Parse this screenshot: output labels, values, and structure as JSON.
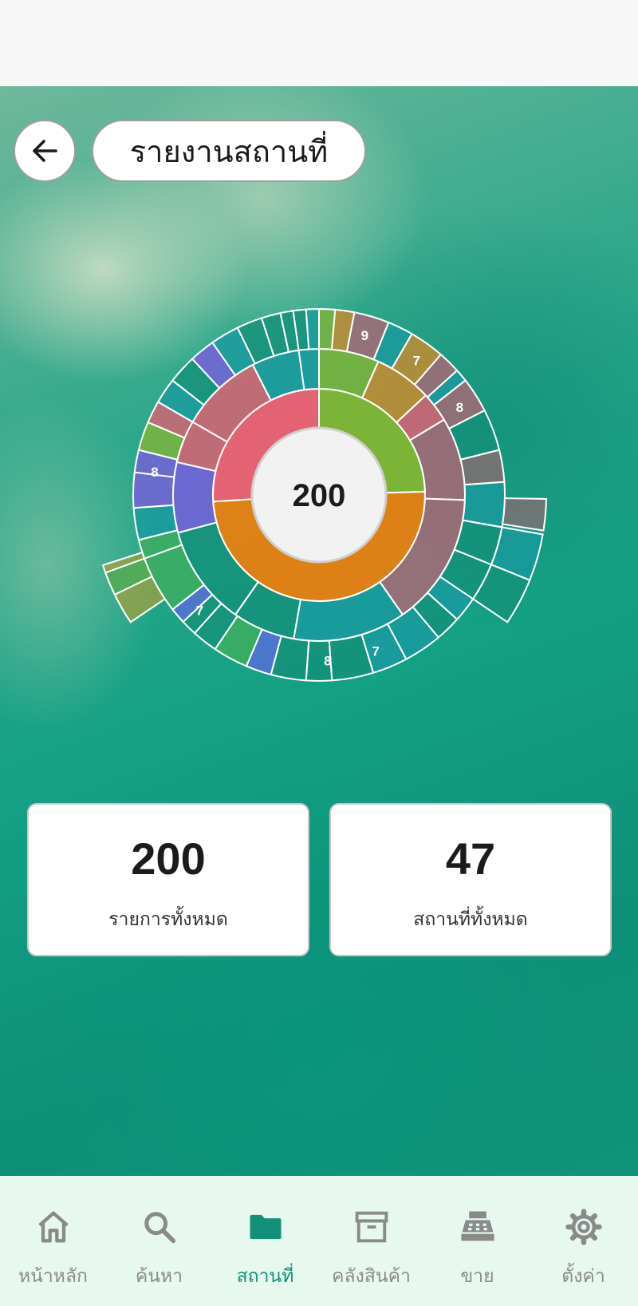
{
  "header": {
    "title": "รายงานสถานที่"
  },
  "colors": {
    "accent": "#14907a",
    "nav_bg": "#e7f9ef",
    "inactive": "#8a8a8a"
  },
  "chart_data": {
    "type": "sunburst",
    "center_label": "200",
    "total": 200,
    "inner_ring": [
      {
        "color": "#82b534",
        "value": 49
      },
      {
        "color": "#e88010",
        "value": 99
      },
      {
        "color": "#ed5f72",
        "value": 52
      }
    ],
    "segment_labels": [
      "9",
      "7",
      "8",
      "8",
      "7",
      "8",
      "7"
    ]
  },
  "stats": [
    {
      "value": "200",
      "label": "รายการทั้งหมด"
    },
    {
      "value": "47",
      "label": "สถานที่ทั้งหมด"
    }
  ],
  "nav": {
    "items": [
      {
        "label": "หน้าหลัก",
        "icon": "home-icon"
      },
      {
        "label": "ค้นหา",
        "icon": "search-icon"
      },
      {
        "label": "สถานที่",
        "icon": "folder-icon",
        "active": true
      },
      {
        "label": "คลังสินค้า",
        "icon": "archive-icon"
      },
      {
        "label": "ขาย",
        "icon": "cash-register-icon"
      },
      {
        "label": "ตั้งค่า",
        "icon": "gear-icon"
      }
    ]
  }
}
